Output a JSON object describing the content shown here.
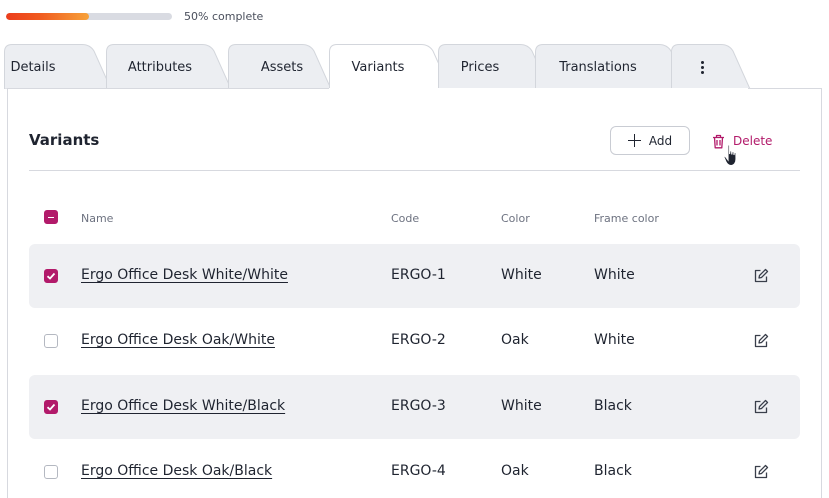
{
  "progress": {
    "value": 0.5,
    "label": "50% complete"
  },
  "tabs": [
    {
      "label": "Details",
      "active": false
    },
    {
      "label": "Attributes",
      "active": false
    },
    {
      "label": "Assets",
      "active": false
    },
    {
      "label": "Variants",
      "active": true
    },
    {
      "label": "Prices",
      "active": false
    },
    {
      "label": "Translations",
      "active": false
    },
    {
      "label": "",
      "icon": "more-vertical-icon",
      "active": false
    }
  ],
  "section": {
    "title": "Variants",
    "add_label": "Add",
    "delete_label": "Delete"
  },
  "table": {
    "columns": [
      "Name",
      "Code",
      "Color",
      "Frame color"
    ],
    "select_all_state": "indeterminate",
    "rows": [
      {
        "selected": true,
        "name": "Ergo Office Desk White/White",
        "code": "ERGO-1",
        "color": "White",
        "frame_color": "White"
      },
      {
        "selected": false,
        "name": "Ergo Office Desk Oak/White",
        "code": "ERGO-2",
        "color": "Oak",
        "frame_color": "White"
      },
      {
        "selected": true,
        "name": "Ergo Office Desk White/Black",
        "code": "ERGO-3",
        "color": "White",
        "frame_color": "Black"
      },
      {
        "selected": false,
        "name": "Ergo Office Desk Oak/Black",
        "code": "ERGO-4",
        "color": "Oak",
        "frame_color": "Black"
      }
    ]
  },
  "colors": {
    "accent": "#b21a6a",
    "progress_start": "#ec3d1c",
    "progress_end": "#f7a23a",
    "selected_row_bg": "#eff0f3",
    "tab_inactive_bg": "#eceef2"
  },
  "icons": [
    "plus-icon",
    "trash-icon",
    "edit-icon",
    "more-vertical-icon",
    "pointer-cursor-icon",
    "checkbox-checked-icon",
    "checkbox-indeterminate-icon"
  ]
}
